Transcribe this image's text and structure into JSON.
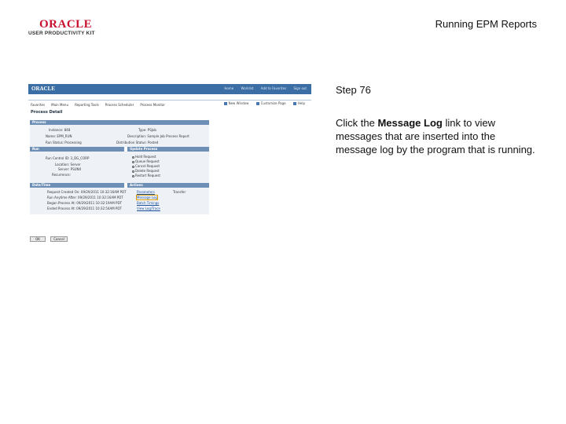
{
  "header": {
    "logo_brand": "ORACLE",
    "logo_product": "USER PRODUCTIVITY KIT",
    "doc_title": "Running EPM Reports"
  },
  "step": {
    "number_label": "Step 76",
    "instruction_pre": "Click the ",
    "instruction_bold": "Message Log",
    "instruction_post": " link to view messages that are inserted into the message log by the program that is running."
  },
  "screenshot": {
    "brand": "ORACLE",
    "top_links": [
      "Home",
      "Worklist",
      "Add to Favorites",
      "Sign out"
    ],
    "menu": [
      "Favorites",
      "Main Menu",
      "Reporting Tools",
      "Process Scheduler",
      "Process Monitor"
    ],
    "toolbar": [
      "New Window",
      "Customize Page",
      "Help"
    ],
    "page_title": "Process Detail",
    "process_bar": "Process",
    "fields": {
      "instance": "Instance: 848",
      "type": "Type: PSJob",
      "name": "Name: EPM_RUN",
      "description": "Description: Sample Job Process Report",
      "run_status": "Run Status: Processing",
      "distribution_status": "Distribution Status: Posted"
    },
    "run_bar": "Run",
    "run_control": "Run Control ID: 3_DG_CORP",
    "location": "Location: Server",
    "server": "Server: PSUNX",
    "recurrence": "Recurrence:",
    "update_bar": "Update Process",
    "update_options": [
      "Hold Request",
      "Queue Request",
      "Cancel Request",
      "Delete Request",
      "Restart Request"
    ],
    "datetime_bar": "Date/Time",
    "datetimes": [
      "Request Created On: 09/29/2011 10:32:16AM PDT",
      "Run Anytime After: 09/29/2011 10:32:16AM PDT",
      "Began Process At: 09/29/2011 10:32:19AM PDT",
      "Ended Process At: 09/29/2011 10:32:54AM PDT"
    ],
    "actions_bar": "Actions",
    "actions": [
      "Parameters",
      "Message Log",
      "Batch Timings",
      "View Log/Trace"
    ],
    "transfer": "Transfer",
    "buttons": [
      "OK",
      "Cancel"
    ]
  },
  "colors": {
    "brand_red": "#c8102e",
    "banner_blue": "#3b6ea5",
    "section_bar": "#6e8fb5"
  }
}
